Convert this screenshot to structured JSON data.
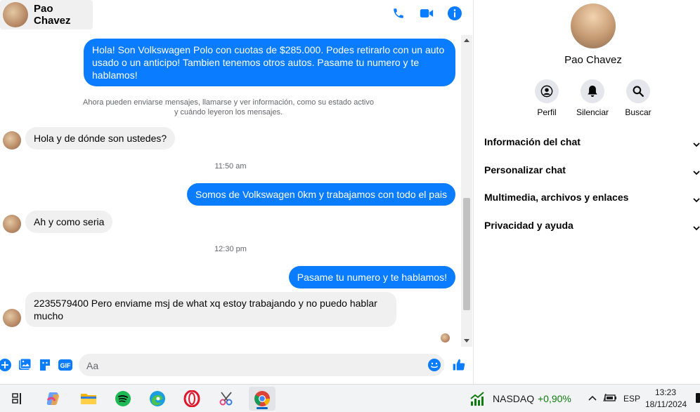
{
  "header": {
    "contact_name": "Pao Chavez",
    "icons": [
      "phone-icon",
      "video-icon",
      "info-icon"
    ]
  },
  "messages": {
    "m1": "Hola! Son Volkswagen Polo con cuotas de $285.000. Podes retirarlo con un auto usado o un anticipo! Tambien tenemos otros autos. Pasame tu numero y te hablamos!",
    "system_note_line1": "Ahora pueden enviarse mensajes, llamarse y ver información, como su estado activo",
    "system_note_line2": "y cuándo leyeron los mensajes.",
    "m2": "Hola y de dónde son ustedes?",
    "time1": "11:50 am",
    "m3": "Somos de Volkswagen 0km y trabajamos con todo el pais",
    "m4": "Ah y como seria",
    "time2": "12:30 pm",
    "m5": "Pasame tu numero y te hablamos!",
    "m6": "2235579400 Pero enviame msj de what xq estoy trabajando y no puedo hablar mucho"
  },
  "composer": {
    "placeholder": "Aa"
  },
  "panel": {
    "name": "Pao Chavez",
    "actions": {
      "profile": "Perfil",
      "mute": "Silenciar",
      "search": "Buscar"
    },
    "sections": {
      "chat_info": "Información del chat",
      "customize": "Personalizar chat",
      "media": "Multimedia, archivos y enlaces",
      "privacy": "Privacidad y ayuda"
    }
  },
  "taskbar": {
    "stock_name": "NASDAQ",
    "stock_change": "+0,90%",
    "language": "ESP",
    "time": "13:23",
    "date": "18/11/2024"
  },
  "colors": {
    "accent": "#0a7cff",
    "incoming_bubble": "#f0f0f0",
    "stock_up": "#107c10"
  }
}
